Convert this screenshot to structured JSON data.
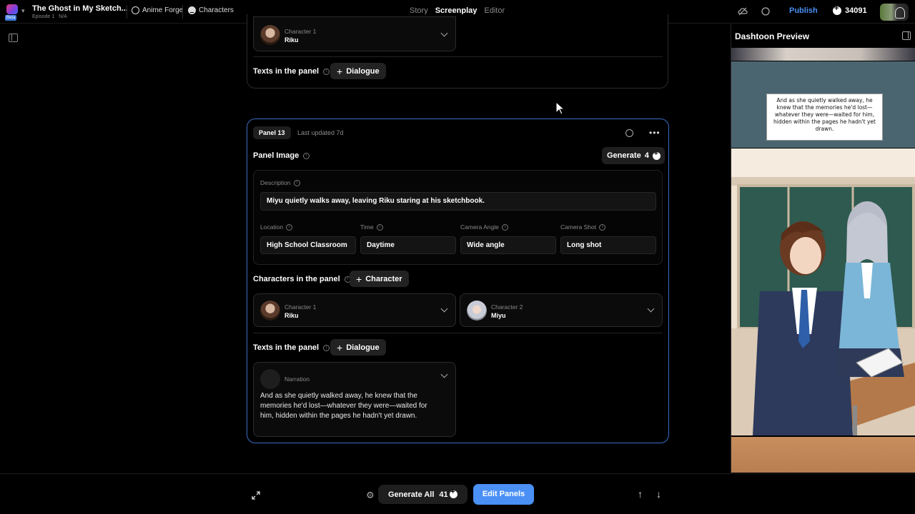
{
  "app": {
    "project_title": "The Ghost in My Sketch...",
    "episode": "Episode 1",
    "episode_status": "N/A",
    "beta_badge": "Beta",
    "forge_link": "Anime Forge",
    "characters_link": "Characters"
  },
  "modes": [
    {
      "label": "Story",
      "active": false
    },
    {
      "label": "Screenplay",
      "active": true
    },
    {
      "label": "Editor",
      "active": false
    }
  ],
  "topbar": {
    "publish_label": "Publish",
    "credits": "34091",
    "accent_color": "#4a90f5"
  },
  "previous_panel": {
    "character": {
      "role": "Character 1",
      "name": "Riku"
    },
    "texts_label": "Texts in the panel",
    "dialogue_button": "Dialogue"
  },
  "panel": {
    "number_label": "Panel 13",
    "updated": "Last updated 7d",
    "image_label": "Panel Image",
    "generate_label": "Generate",
    "generate_cost": "4",
    "description_label": "Description",
    "description": "Miyu quietly walks away, leaving Riku staring at his sketchbook.",
    "fields": [
      {
        "label": "Location",
        "value": "High School Classroom"
      },
      {
        "label": "Time",
        "value": "Daytime"
      },
      {
        "label": "Camera Angle",
        "value": "Wide angle"
      },
      {
        "label": "Camera Shot",
        "value": "Long shot"
      }
    ],
    "characters_label": "Characters in the panel",
    "character_button": "Character",
    "characters": [
      {
        "role": "Character 1",
        "name": "Riku"
      },
      {
        "role": "Character 2",
        "name": "Miyu"
      }
    ],
    "texts_label": "Texts in the panel",
    "dialogue_button": "Dialogue",
    "narration": {
      "label": "Narration",
      "text": "And as she quietly walked away, he knew that the memories he'd lost—whatever they were—waited for him, hidden within the pages he hadn't yet drawn."
    }
  },
  "preview": {
    "title": "Dashtoon Preview",
    "narration_text": "And as she quietly walked away, he knew that the memories he'd lost—whatever they were—waited for him, hidden within the pages he hadn't yet drawn."
  },
  "bottombar": {
    "generate_all_label": "Generate All",
    "generate_all_cost": "41",
    "edit_panels_label": "Edit Panels"
  }
}
